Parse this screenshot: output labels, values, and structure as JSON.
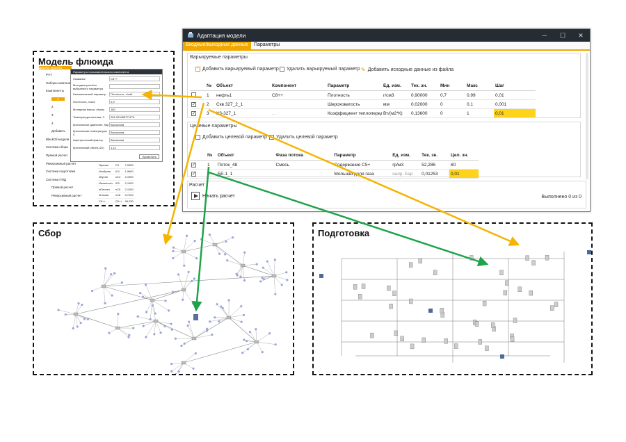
{
  "panels": {
    "fluid": {
      "title": "Модель флюида"
    },
    "gathering": {
      "title": "Сбор"
    },
    "treatment": {
      "title": "Подготовка"
    }
  },
  "window": {
    "title": "Адаптация модели",
    "icon": "app-icon",
    "tabs": [
      {
        "label": "Входные/выходные данные",
        "active": true
      },
      {
        "label": "Параметры",
        "active": false
      }
    ],
    "varied": {
      "label": "Варьируемые параметры",
      "add_button": "Добавить варьируемый параметр",
      "remove_button": "Удалить варьируемый параметр",
      "import_button": "Добавить исходные данные из файла",
      "columns": [
        "№",
        "Объект",
        "Компонент",
        "Параметр",
        "Ед. изм.",
        "Тек. зн.",
        "Мин",
        "Макс",
        "Шаг"
      ],
      "rows": [
        {
          "checked": false,
          "n": "1",
          "object": "нефть1",
          "component": "С8++",
          "param": "Плотность",
          "unit": "г/см3",
          "current": "0,90000",
          "min": "0,7",
          "max": "0,99",
          "step": "0,01"
        },
        {
          "checked": true,
          "n": "2",
          "object": "Скв 327_2_1",
          "component": "",
          "param": "Шероховатость",
          "unit": "мм",
          "current": "0,02000",
          "min": "0",
          "max": "0,1",
          "step": "0,001"
        },
        {
          "checked": true,
          "n": "3",
          "object": "УЗ-327_1",
          "component": "...",
          "param": "Коэффициент теплоперед",
          "unit": "Вт/(м2*К)",
          "current": "0,13600",
          "min": "0",
          "max": "1",
          "step": "0,01"
        }
      ]
    },
    "target": {
      "label": "Целевые параметры",
      "add_button": "Добавить целевой параметр",
      "remove_button": "Удалить целевой параметр",
      "columns": [
        "№",
        "Объект",
        "Фаза потока",
        "Параметр",
        "Ед. изм.",
        "Тек. зн.",
        "Цел. зн."
      ],
      "rows": [
        {
          "checked": true,
          "n": "1",
          "object": "Поток_48",
          "phase": "Смесь",
          "param": "Содержание С5+",
          "unit": "гр/м3",
          "current": "52,286",
          "target": "60"
        },
        {
          "checked": true,
          "n": "2",
          "object": "БЕ-1_1",
          "phase": "",
          "param": "Мольная доля газа",
          "unit": "напр. Бар",
          "current": "0,01253",
          "target": "0,01"
        }
      ]
    },
    "calc": {
      "label": "Расчет",
      "start_button": "Начать расчет",
      "status": "Выполнено 0 из 0"
    }
  },
  "fluid_window": {
    "title": "Параметры пользовательского компонента",
    "rows": [
      {
        "label": "Название",
        "value": "С8++"
      },
      {
        "label": "Методика расчёта выбранного параметра",
        "value": ""
      },
      {
        "label": "Неизменяемый параметр",
        "value": "Плотность, г/см3"
      },
      {
        "label": "Плотность, г/см3",
        "value": "0,9"
      },
      {
        "label": "Молярная масса, г/моль",
        "value": "180"
      },
      {
        "label": "Температура кипения, С",
        "value": "281,923488771176"
      },
      {
        "label": "Критическое давление, бар",
        "value": "Вычислим"
      },
      {
        "label": "Критическая температура, С",
        "value": "Вычислим"
      },
      {
        "label": "Ацентрический фактор",
        "value": "Вычислим"
      },
      {
        "label": "Критический объем (Zc)",
        "value": "1,12"
      }
    ],
    "apply_button": "Применить"
  },
  "tree": {
    "header": "Дерево проекта",
    "items": [
      "PVT",
      "Наборы компонентов",
      "Компоненты",
      "1",
      "2",
      "3",
      "4",
      "Добавить",
      "BlackOil модели",
      "Система сбора",
      "Прямой расчет",
      "Реверсивный расчет",
      "Система подготовки",
      "Система ППД",
      "Прямой расчет",
      "Реверсивный расчет"
    ]
  },
  "components": [
    [
      "Пропан",
      "С3",
      "7,0900"
    ],
    [
      "Изобутан",
      "iC4",
      "1,9600"
    ],
    [
      "нБутан",
      "nC4",
      "4,1900"
    ],
    [
      "Изопентан",
      "iC5",
      "2,1200"
    ],
    [
      "нПентан",
      "nC5",
      "2,1200"
    ],
    [
      "нГексан",
      "nC6",
      "3,7100"
    ],
    [
      "С8++",
      "С8++",
      "48,230"
    ]
  ],
  "colors": {
    "accent": "#f0a800",
    "highlight": "#ffd319",
    "arrow_yellow": "#f5b400",
    "arrow_green": "#1fa34a",
    "titlebar": "#262c33"
  }
}
